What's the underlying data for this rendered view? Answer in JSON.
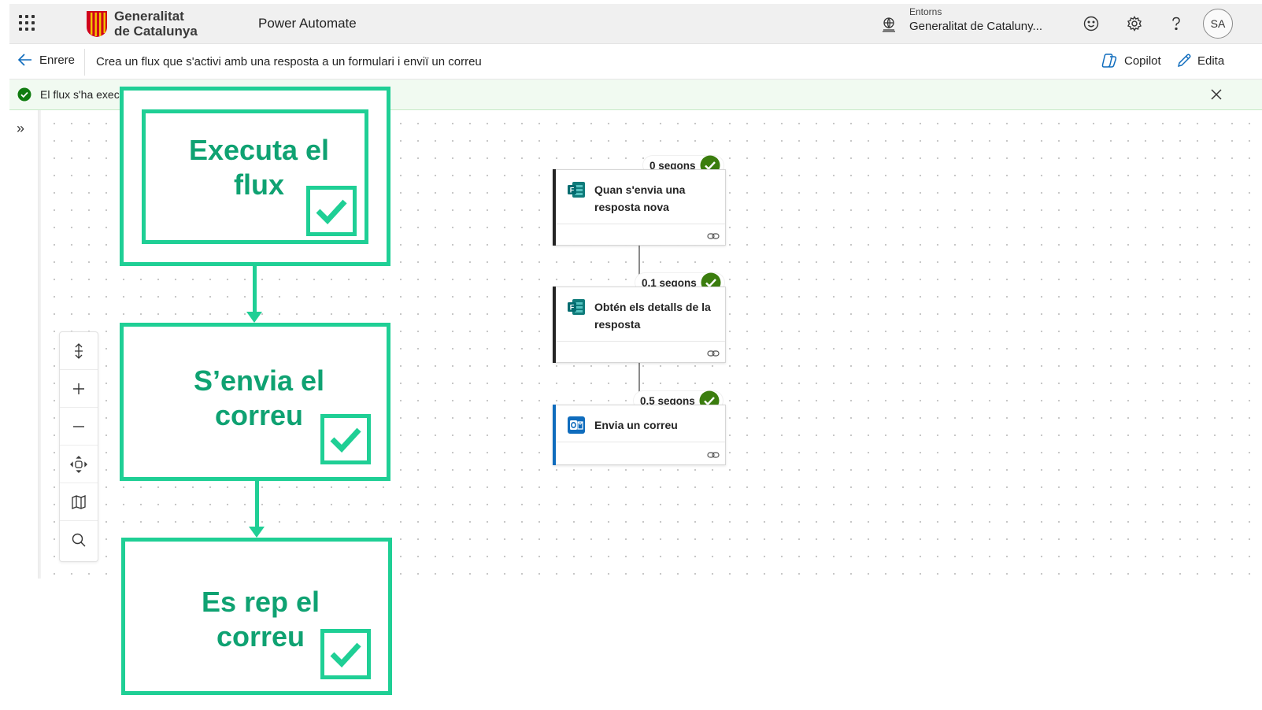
{
  "header": {
    "logo_line1": "Generalitat",
    "logo_line2": "de Catalunya",
    "app_name": "Power Automate",
    "env_label": "Entorns",
    "env_value": "Generalitat de Cataluny...",
    "avatar_initials": "SA"
  },
  "commandbar": {
    "back_label": "Enrere",
    "flow_title": "Crea un flux que s'activi amb una resposta a un formulari i enviï un correu",
    "copilot_label": "Copilot",
    "edit_label": "Edita"
  },
  "banner": {
    "text": "El flux s'ha executat correctament."
  },
  "flow": {
    "steps": [
      {
        "duration": "0 segons",
        "title": "Quan s'envia una resposta nova",
        "app": "Forms",
        "color": "#242424"
      },
      {
        "duration": "0,1 segons",
        "title": "Obtén els detalls de la resposta",
        "app": "Forms",
        "color": "#242424"
      },
      {
        "duration": "0,5 segons",
        "title": "Envia un correu",
        "app": "Outlook",
        "color": "#0f6cbd"
      }
    ]
  },
  "annotations": {
    "box1_line1": "Executa el",
    "box1_line2": "flux",
    "box2_line1": "S’envia el",
    "box2_line2": "correu",
    "box3_line1": "Es rep el",
    "box3_line2": "correu",
    "accent_color": "#1fcf95"
  },
  "icons": {
    "waffle": "app-launcher-icon",
    "environment": "environment-globe-icon",
    "feedback": "smiley-icon",
    "settings": "gear-icon",
    "help": "question-icon",
    "back": "arrow-left-icon",
    "copilot": "copilot-icon",
    "edit": "pencil-icon",
    "success": "checkmark-circle-icon",
    "close": "close-icon",
    "expand": "double-chevron-right-icon",
    "fit": "fit-vertical-icon",
    "zoom_in": "plus-icon",
    "zoom_out": "minus-icon",
    "center": "center-icon",
    "minimap": "map-icon",
    "search": "search-icon"
  }
}
